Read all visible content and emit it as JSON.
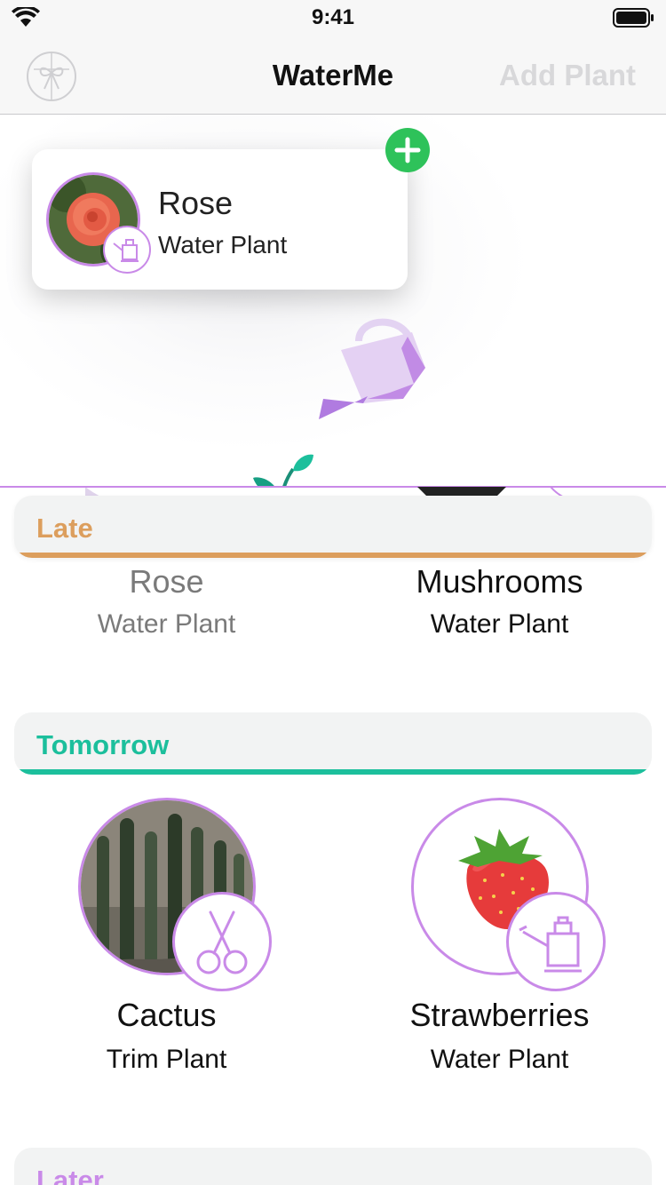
{
  "status_bar": {
    "time": "9:41"
  },
  "nav": {
    "title": "WaterMe",
    "right_button": "Add Plant",
    "left_icon": "settings-ribbon-icon"
  },
  "drag_card": {
    "title": "Rose",
    "subtitle": "Water Plant",
    "badge_icon": "plus-icon"
  },
  "colors": {
    "accent": "#c98ae8",
    "late": "#dc9e5d",
    "tomorrow": "#1cbf9c",
    "later": "#c98ae8",
    "add_green": "#2ec25a"
  },
  "sections": [
    {
      "label": "Late",
      "items": [
        {
          "name": "Rose",
          "action": "Water Plant"
        },
        {
          "name": "Mushrooms",
          "action": "Water Plant"
        }
      ]
    },
    {
      "label": "Tomorrow",
      "items": [
        {
          "name": "Cactus",
          "action": "Trim Plant",
          "icon": "scissors-icon"
        },
        {
          "name": "Strawberries",
          "action": "Water Plant",
          "icon": "watering-can-icon"
        }
      ]
    },
    {
      "label": "Later",
      "items": []
    }
  ]
}
